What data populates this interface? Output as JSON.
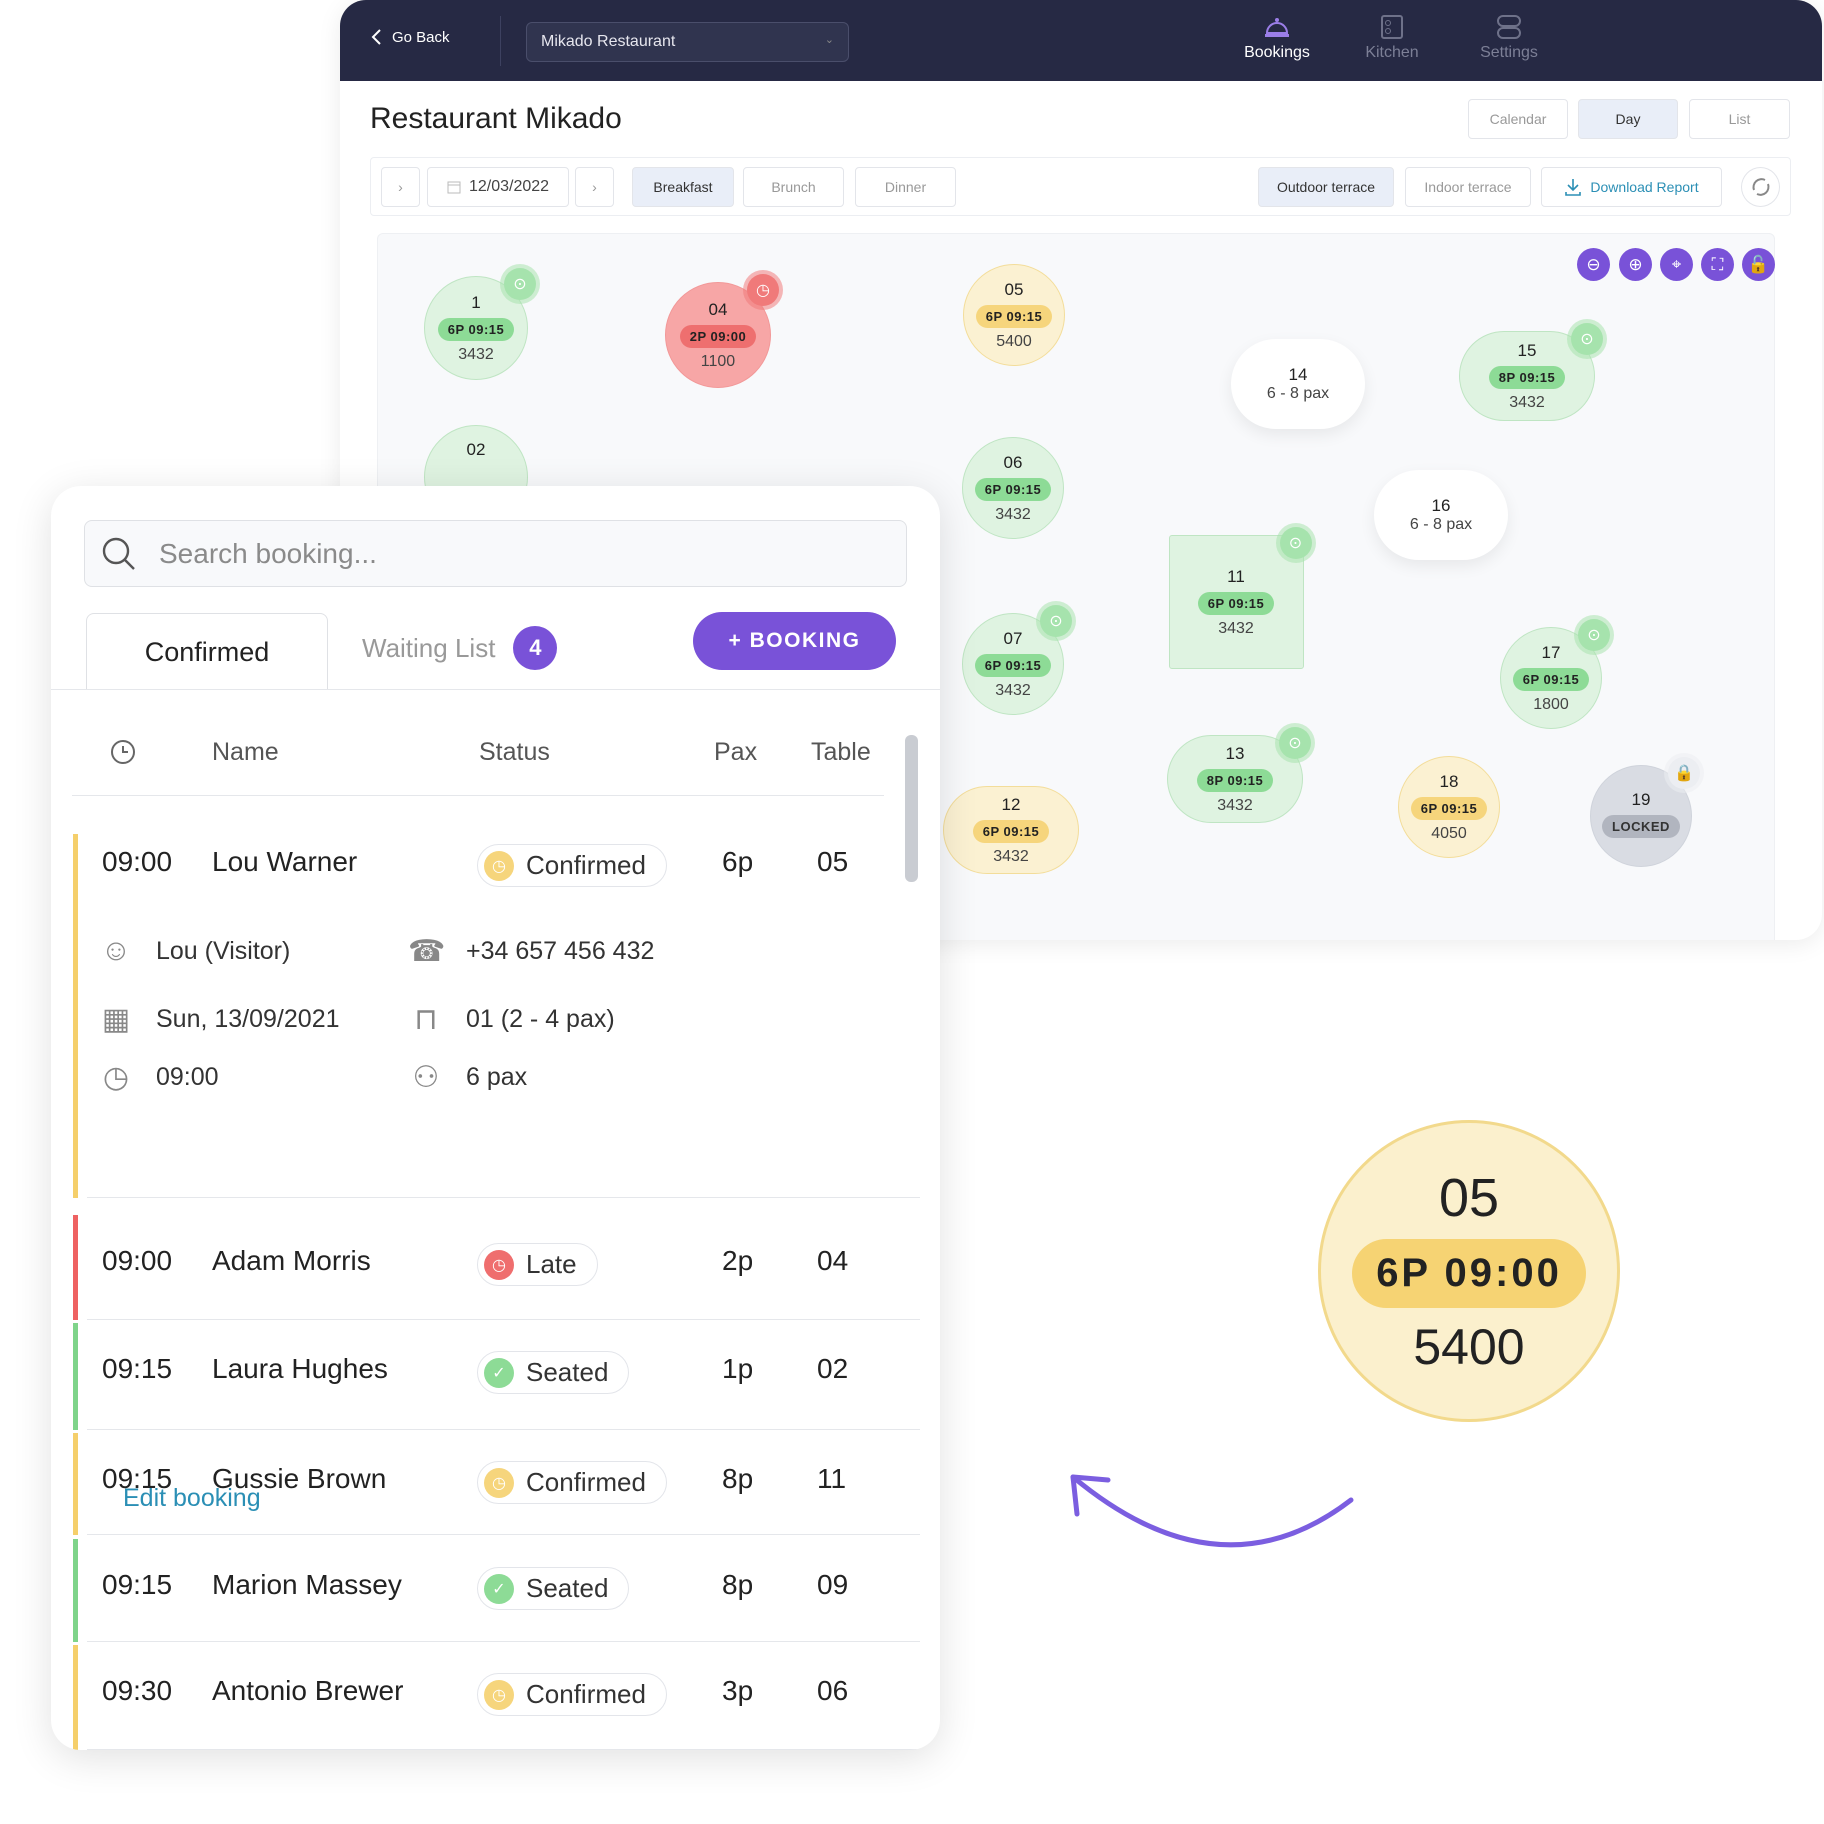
{
  "nav": {
    "go_back": "Go Back",
    "restaurant_select": "Mikado Restaurant",
    "tabs": [
      {
        "label": "Bookings",
        "icon": "bell-icon",
        "active": true
      },
      {
        "label": "Kitchen",
        "icon": "stove-icon",
        "active": false
      },
      {
        "label": "Settings",
        "icon": "toggles-icon",
        "active": false
      }
    ]
  },
  "page_title": "Restaurant Mikado",
  "views": {
    "calendar": "Calendar",
    "day": "Day",
    "list": "List",
    "selected": "Day"
  },
  "toolbar": {
    "date": "12/03/2022",
    "services": [
      "Breakfast",
      "Brunch",
      "Dinner"
    ],
    "selected_service": "Breakfast",
    "areas": [
      "Outdoor terrace",
      "Indoor terrace"
    ],
    "selected_area": "Outdoor terrace",
    "download": "Download Report"
  },
  "map_tools": [
    "zoom-out-icon",
    "zoom-in-icon",
    "crosshair-icon",
    "fullscreen-icon",
    "unlock-icon"
  ],
  "tables": [
    {
      "id": "1",
      "status": "seated",
      "pill": "6P  09:15",
      "sub": "3432",
      "badge": "waiter"
    },
    {
      "id": "04",
      "status": "late",
      "pill": "2P 09:00",
      "sub": "1100",
      "badge": "clock"
    },
    {
      "id": "05",
      "status": "confirmed",
      "pill": "6P  09:15",
      "sub": "5400"
    },
    {
      "id": "02",
      "status": "seated"
    },
    {
      "id": "06",
      "status": "seated",
      "pill": "6P  09:15",
      "sub": "3432"
    },
    {
      "id": "07",
      "status": "seated",
      "pill": "6P  09:15",
      "sub": "3432",
      "badge": "waiter"
    },
    {
      "id": "12",
      "status": "confirmed",
      "pill": "6P  09:15",
      "sub": "3432"
    },
    {
      "id": "11",
      "status": "seated",
      "pill": "6P  09:15",
      "sub": "3432",
      "badge": "waiter"
    },
    {
      "id": "13",
      "status": "seated",
      "pill": "8P 09:15",
      "sub": "3432",
      "badge": "waiter"
    },
    {
      "id": "14",
      "status": "free",
      "sub": "6 - 8 pax"
    },
    {
      "id": "16",
      "status": "free",
      "sub": "6 - 8 pax"
    },
    {
      "id": "15",
      "status": "seated",
      "pill": "8P 09:15",
      "sub": "3432",
      "badge": "waiter"
    },
    {
      "id": "17",
      "status": "seated",
      "pill": "6P  09:15",
      "sub": "1800",
      "badge": "waiter"
    },
    {
      "id": "18",
      "status": "confirmed",
      "pill": "6P  09:15",
      "sub": "4050"
    },
    {
      "id": "19",
      "status": "locked",
      "pill": "LOCKED",
      "badge": "lock"
    }
  ],
  "panel": {
    "search_placeholder": "Search booking...",
    "tab_confirmed": "Confirmed",
    "tab_waiting": "Waiting List",
    "waiting_count": "4",
    "add_booking": "+ BOOKING",
    "headers": {
      "name": "Name",
      "status": "Status",
      "pax": "Pax",
      "table": "Table"
    },
    "bookings": [
      {
        "time": "09:00",
        "name": "Lou Warner",
        "status": "Confirmed",
        "pax": "6p",
        "table": "05"
      },
      {
        "time": "09:00",
        "name": "Adam Morris",
        "status": "Late",
        "pax": "2p",
        "table": "04"
      },
      {
        "time": "09:15",
        "name": "Laura Hughes",
        "status": "Seated",
        "pax": "1p",
        "table": "02"
      },
      {
        "time": "09:15",
        "name": "Gussie Brown",
        "status": "Confirmed",
        "pax": "8p",
        "table": "11"
      },
      {
        "time": "09:15",
        "name": "Marion Massey",
        "status": "Seated",
        "pax": "8p",
        "table": "09"
      },
      {
        "time": "09:30",
        "name": "Antonio Brewer",
        "status": "Confirmed",
        "pax": "3p",
        "table": "06"
      }
    ],
    "details": {
      "guest": "Lou  (Visitor)",
      "phone": "+34 657 456 432",
      "date": "Sun, 13/09/2021",
      "table": "01 (2 - 4 pax)",
      "time": "09:00",
      "pax": "6 pax",
      "edit": "Edit booking"
    }
  },
  "zoomed_table": {
    "id": "05",
    "pill": "6P  09:00",
    "sub": "5400"
  },
  "colors": {
    "nav": "#262944",
    "accent": "#7952d8",
    "seated": "#8ddb96",
    "late": "#ee6f6f",
    "confirmed": "#f6d57c",
    "locked": "#b1b5bf",
    "link": "#2b8fb5"
  }
}
